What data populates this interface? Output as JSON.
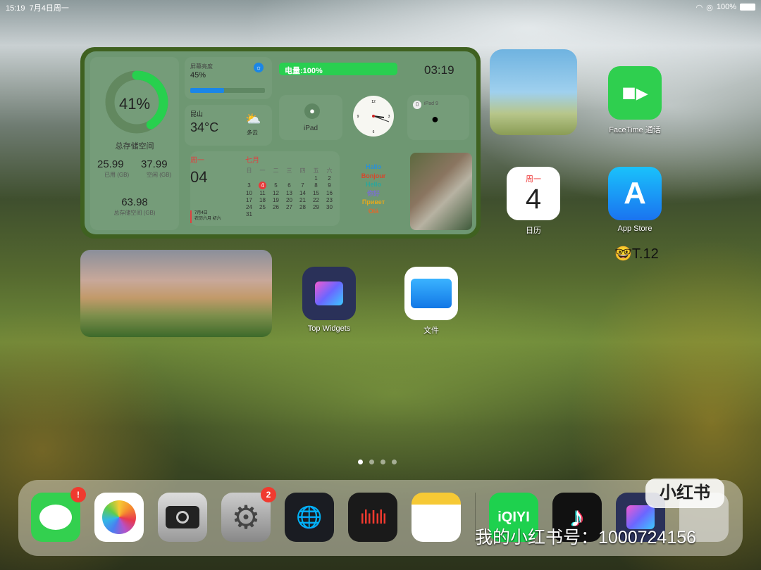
{
  "status": {
    "time": "15:19",
    "date": "7月4日周一",
    "battery": "100%"
  },
  "widget": {
    "storage": {
      "percent": "41%",
      "percent_value": 41,
      "label": "总存储空间",
      "used": "25.99",
      "used_label": "已用 (GB)",
      "free": "37.99",
      "free_label": "空闲 (GB)",
      "total": "63.98",
      "total_label": "总存储空间 (GB)"
    },
    "brightness": {
      "label": "屏幕亮度",
      "value": "45%",
      "level": 45
    },
    "battery": {
      "label": "电量:100%",
      "level": 100
    },
    "time": "03:19",
    "weather": {
      "city": "昆山",
      "temp": "34°C",
      "cond": "多云"
    },
    "device": {
      "name": "iPad",
      "model": "iPad 9"
    },
    "clock": {
      "n12": "12",
      "n3": "3",
      "n6": "6",
      "n9": "9"
    },
    "calendar": {
      "weekday": "周一",
      "day": "04",
      "month": "七月",
      "date_text": "7月4日",
      "lunar": "农历六月 初六",
      "headers": [
        "日",
        "一",
        "二",
        "三",
        "四",
        "五",
        "六"
      ],
      "weeks": [
        [
          "",
          "",
          "",
          "",
          "",
          "1",
          "2"
        ],
        [
          "3",
          "4",
          "5",
          "6",
          "7",
          "8",
          "9"
        ],
        [
          "10",
          "11",
          "12",
          "13",
          "14",
          "15",
          "16"
        ],
        [
          "17",
          "18",
          "19",
          "20",
          "21",
          "22",
          "23"
        ],
        [
          "24",
          "25",
          "26",
          "27",
          "28",
          "29",
          "30"
        ],
        [
          "31",
          "",
          "",
          "",
          "",
          "",
          ""
        ]
      ],
      "today": "4"
    },
    "greetings": [
      {
        "text": "Hallo",
        "color": "#2a8fd6"
      },
      {
        "text": "Bonjour",
        "color": "#d8452b"
      },
      {
        "text": "Hello",
        "color": "#2aa79c"
      },
      {
        "text": "你好",
        "color": "#7a6fd0"
      },
      {
        "text": "Привет",
        "color": "#e4a81d"
      },
      {
        "text": "Olá",
        "color": "#e0692c"
      }
    ]
  },
  "apps": {
    "facetime": "FaceTime 通话",
    "calendar_day": "4",
    "calendar_weekday": "周一",
    "calendar": "日历",
    "appstore": "App Store",
    "topwidgets": "Top Widgets",
    "files": "文件",
    "note": "🤓T.12"
  },
  "dock": {
    "messages_badge": "!",
    "settings_badge": "2",
    "iqiyi": "iQIYI"
  },
  "watermark": {
    "logo": "小红书",
    "id": "我的小红书号：1000724156"
  }
}
